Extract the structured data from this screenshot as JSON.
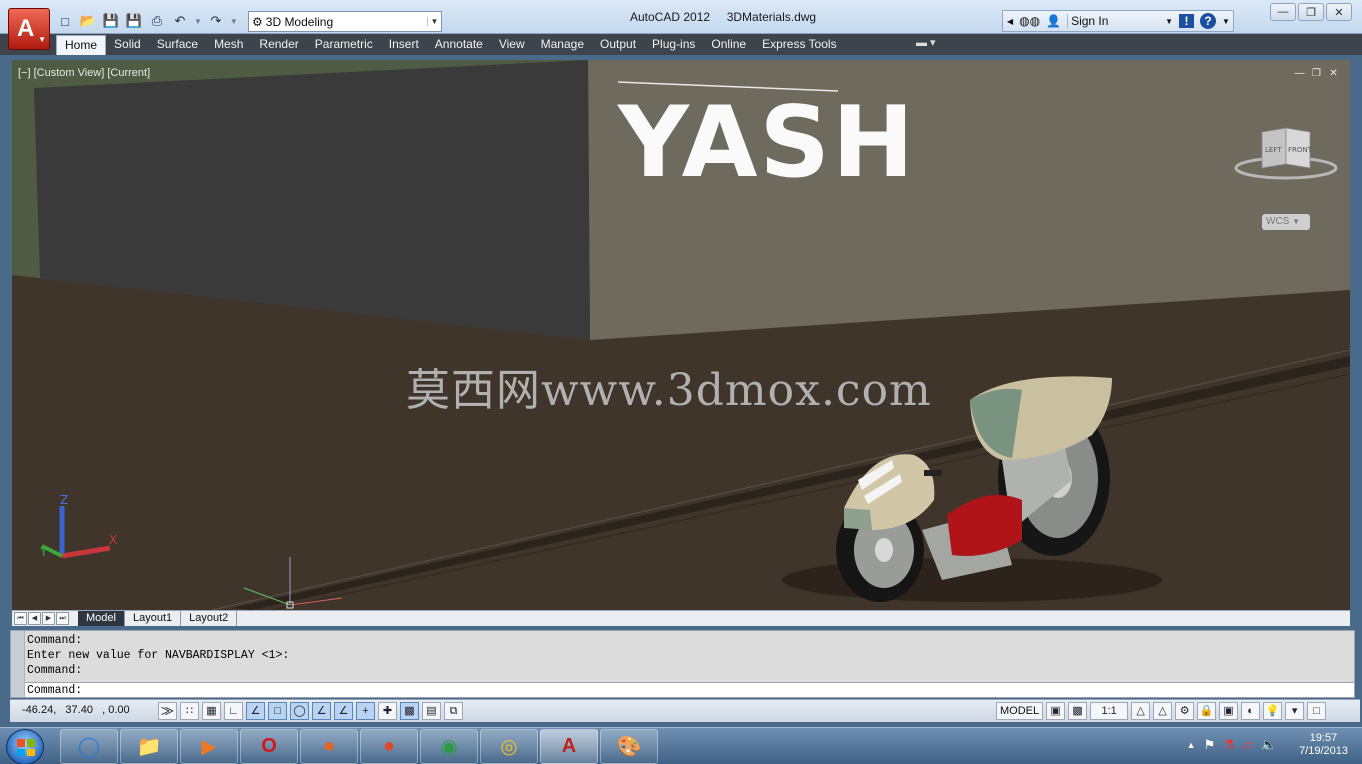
{
  "titlebar": {
    "app_title": "AutoCAD 2012     3DMaterials.dwg",
    "workspace": "3D Modeling",
    "signin": "Sign In",
    "qat_icons": [
      "new-icon",
      "open-icon",
      "save-icon",
      "saveas-icon",
      "plot-icon",
      "undo-icon",
      "redo-icon"
    ]
  },
  "ribbon": {
    "tabs": [
      "Home",
      "Solid",
      "Surface",
      "Mesh",
      "Render",
      "Parametric",
      "Insert",
      "Annotate",
      "View",
      "Manage",
      "Output",
      "Plug-ins",
      "Online",
      "Express Tools"
    ],
    "active": "Home"
  },
  "viewport": {
    "label": "[−] [Custom View] [Current]",
    "wall_text": "YASH",
    "watermark": "莫西网www.3dmox.com",
    "viewcube": {
      "left": "LEFT",
      "front": "FRONT"
    },
    "wcs": "WCS"
  },
  "layouts": {
    "tabs": [
      "Model",
      "Layout1",
      "Layout2"
    ],
    "active": "Model"
  },
  "command": {
    "history": [
      "Command:",
      "Enter new value for NAVBARDISPLAY <1>:",
      "Command:"
    ],
    "prompt": "Command:"
  },
  "status": {
    "coords": "-46.24,   37.40   , 0.00",
    "space": "MODEL",
    "scale": "1:1"
  },
  "taskbar": {
    "apps": [
      "Internet Explorer",
      "Windows Explorer",
      "Media Player",
      "Opera",
      "Firefox",
      "Firefox Nightly",
      "Google Chrome",
      "Audio Player",
      "AutoCAD 2012",
      "Paint"
    ],
    "time": "19:57",
    "date": "7/19/2013"
  },
  "colors": {
    "ribbon_bg": "#3e444c",
    "ground": "#40352a",
    "wall_left": "#3a3a3a",
    "wall_right": "#6f6a5e",
    "sky": "#4f5b42"
  }
}
